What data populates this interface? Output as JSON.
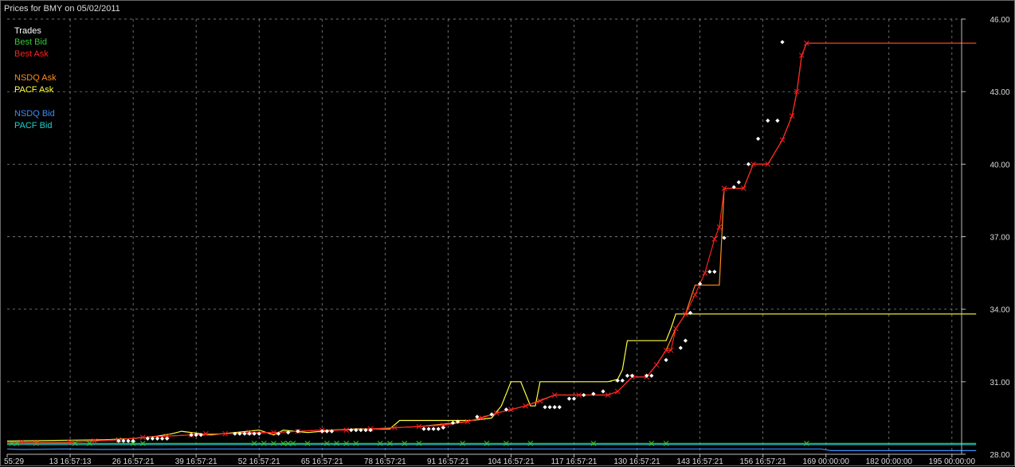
{
  "chart_data": {
    "type": "line",
    "title": "Prices for BMY on 05/02/2011",
    "xlabel": "",
    "ylabel": "",
    "ylim": [
      28.0,
      46.0
    ],
    "xlim": [
      0,
      197
    ],
    "grid": true,
    "legend": "top-left",
    "y_ticks": [
      "46.00",
      "43.00",
      "40.00",
      "37.00",
      "34.00",
      "31.00",
      "28.00"
    ],
    "y_tick_values": [
      46,
      43,
      40,
      37,
      34,
      31,
      28
    ],
    "x_ticks": [
      {
        "x": 0,
        "label": "55:29"
      },
      {
        "x": 13,
        "label": "13 16:57:13"
      },
      {
        "x": 26,
        "label": "26 16:57:21"
      },
      {
        "x": 39,
        "label": "39 16:57:21"
      },
      {
        "x": 52,
        "label": "52 16:57:21"
      },
      {
        "x": 65,
        "label": "65 16:57:21"
      },
      {
        "x": 78,
        "label": "78 16:57:21"
      },
      {
        "x": 91,
        "label": "91 16:57:21"
      },
      {
        "x": 104,
        "label": "104 16:57:21"
      },
      {
        "x": 117,
        "label": "117 16:57:21"
      },
      {
        "x": 130,
        "label": "130 16:57:21"
      },
      {
        "x": 143,
        "label": "143 16:57:21"
      },
      {
        "x": 156,
        "label": "156 16:57:21"
      },
      {
        "x": 169,
        "label": "169 00:00:00"
      },
      {
        "x": 182,
        "label": "182 00:00:00"
      },
      {
        "x": 195,
        "label": "195 00:00:00"
      }
    ],
    "legend_entries": [
      {
        "name": "Trades",
        "color": "#ffffff"
      },
      {
        "name": "Best Bid",
        "color": "#32cd32"
      },
      {
        "name": "Best Ask",
        "color": "#ff2020"
      },
      {
        "name": "NSDQ Ask",
        "color": "#ff8c1a"
      },
      {
        "name": "PACF Ask",
        "color": "#ffff40"
      },
      {
        "name": "NSDQ Bid",
        "color": "#3a8cff"
      },
      {
        "name": "PACF Bid",
        "color": "#20d0d0"
      }
    ],
    "series": [
      {
        "name": "Best Ask",
        "kind": "step-line-with-x-markers",
        "color": "#ff2020",
        "points": [
          [
            0,
            28.5
          ],
          [
            3,
            28.5
          ],
          [
            6,
            28.5
          ],
          [
            13,
            28.5
          ],
          [
            18,
            28.55
          ],
          [
            23,
            28.6
          ],
          [
            28,
            28.7
          ],
          [
            33,
            28.75
          ],
          [
            38,
            28.8
          ],
          [
            41,
            28.85
          ],
          [
            45,
            28.85
          ],
          [
            50,
            28.9
          ],
          [
            55,
            28.9
          ],
          [
            60,
            28.95
          ],
          [
            65,
            29.0
          ],
          [
            70,
            29.0
          ],
          [
            75,
            29.05
          ],
          [
            80,
            29.1
          ],
          [
            85,
            29.15
          ],
          [
            90,
            29.2
          ],
          [
            95,
            29.35
          ],
          [
            98,
            29.5
          ],
          [
            101,
            29.7
          ],
          [
            104,
            29.85
          ],
          [
            107,
            30.0
          ],
          [
            110,
            30.2
          ],
          [
            113,
            30.45
          ],
          [
            118,
            30.45
          ],
          [
            124,
            30.45
          ],
          [
            126,
            30.6
          ],
          [
            129,
            31.2
          ],
          [
            132,
            31.2
          ],
          [
            134,
            31.7
          ],
          [
            136,
            32.3
          ],
          [
            137,
            32.3
          ],
          [
            138,
            33.2
          ],
          [
            140,
            33.8
          ],
          [
            142,
            34.6
          ],
          [
            144,
            35.5
          ],
          [
            146,
            36.9
          ],
          [
            147,
            37.4
          ],
          [
            148,
            39.0
          ],
          [
            152,
            39.0
          ],
          [
            154,
            40.0
          ],
          [
            157,
            40.0
          ],
          [
            160,
            41.0
          ],
          [
            162,
            42.0
          ],
          [
            163,
            43.0
          ],
          [
            164,
            44.5
          ],
          [
            165,
            45.0
          ],
          [
            200,
            45.0
          ]
        ]
      },
      {
        "name": "NSDQ Ask",
        "kind": "step-line",
        "color": "#ff8c1a",
        "points": [
          [
            0,
            28.5
          ],
          [
            13,
            28.5
          ],
          [
            18,
            28.55
          ],
          [
            23,
            28.6
          ],
          [
            28,
            28.7
          ],
          [
            33,
            28.75
          ],
          [
            38,
            28.8
          ],
          [
            45,
            28.85
          ],
          [
            55,
            28.9
          ],
          [
            65,
            29.0
          ],
          [
            75,
            29.05
          ],
          [
            85,
            29.15
          ],
          [
            95,
            29.35
          ],
          [
            101,
            29.7
          ],
          [
            107,
            30.0
          ],
          [
            113,
            30.45
          ],
          [
            124,
            30.45
          ],
          [
            126,
            30.6
          ],
          [
            129,
            31.2
          ],
          [
            132,
            31.2
          ],
          [
            134,
            31.7
          ],
          [
            136,
            32.3
          ],
          [
            138,
            33.2
          ],
          [
            140,
            33.8
          ],
          [
            142,
            35.0
          ],
          [
            147,
            35.0
          ],
          [
            148,
            39.0
          ],
          [
            152,
            39.0
          ],
          [
            154,
            40.0
          ],
          [
            157,
            40.0
          ],
          [
            160,
            41.0
          ],
          [
            162,
            42.0
          ],
          [
            163,
            43.0
          ],
          [
            164,
            44.5
          ],
          [
            165,
            45.0
          ],
          [
            200,
            45.0
          ]
        ]
      },
      {
        "name": "PACF Ask",
        "kind": "line",
        "color": "#ffff40",
        "points": [
          [
            0,
            28.55
          ],
          [
            20,
            28.6
          ],
          [
            26,
            28.65
          ],
          [
            31,
            28.75
          ],
          [
            34,
            28.85
          ],
          [
            36,
            28.95
          ],
          [
            42,
            28.8
          ],
          [
            47,
            28.9
          ],
          [
            52,
            29.0
          ],
          [
            55,
            28.8
          ],
          [
            57,
            29.0
          ],
          [
            62,
            28.9
          ],
          [
            68,
            29.0
          ],
          [
            72,
            29.05
          ],
          [
            75,
            29.05
          ],
          [
            79,
            29.05
          ],
          [
            81,
            29.4
          ],
          [
            96,
            29.4
          ],
          [
            100,
            29.5
          ],
          [
            102,
            30.0
          ],
          [
            104,
            31.0
          ],
          [
            106,
            31.0
          ],
          [
            108,
            30.0
          ],
          [
            109,
            30.0
          ],
          [
            110,
            31.0
          ],
          [
            124,
            31.0
          ],
          [
            126,
            31.1
          ],
          [
            127,
            31.5
          ],
          [
            128,
            32.7
          ],
          [
            136,
            32.7
          ],
          [
            137,
            33.2
          ],
          [
            138,
            33.8
          ],
          [
            200,
            33.8
          ]
        ]
      },
      {
        "name": "Best Bid",
        "kind": "line-with-x-markers",
        "color": "#32cd32",
        "points": [
          [
            0,
            28.45
          ],
          [
            200,
            28.45
          ]
        ]
      },
      {
        "name": "PACF Bid",
        "kind": "line",
        "color": "#20d0d0",
        "points": [
          [
            0,
            28.4
          ],
          [
            200,
            28.4
          ]
        ]
      },
      {
        "name": "NSDQ Bid",
        "kind": "line",
        "color": "#3a8cff",
        "points": [
          [
            0,
            28.22
          ],
          [
            3,
            28.2
          ],
          [
            12,
            28.22
          ],
          [
            20,
            28.2
          ],
          [
            40,
            28.22
          ],
          [
            100,
            28.22
          ],
          [
            168,
            28.22
          ],
          [
            170,
            28.15
          ],
          [
            200,
            28.15
          ]
        ]
      },
      {
        "name": "Trades",
        "kind": "diamonds",
        "color": "#ffffff",
        "points": [
          [
            23,
            28.55
          ],
          [
            24,
            28.55
          ],
          [
            25,
            28.55
          ],
          [
            26,
            28.55
          ],
          [
            29,
            28.65
          ],
          [
            30,
            28.65
          ],
          [
            31,
            28.65
          ],
          [
            32,
            28.65
          ],
          [
            33,
            28.65
          ],
          [
            38,
            28.8
          ],
          [
            39,
            28.8
          ],
          [
            40,
            28.8
          ],
          [
            47,
            28.85
          ],
          [
            48,
            28.85
          ],
          [
            49,
            28.85
          ],
          [
            50,
            28.85
          ],
          [
            51,
            28.85
          ],
          [
            52,
            28.85
          ],
          [
            56,
            28.85
          ],
          [
            58,
            28.9
          ],
          [
            60,
            28.95
          ],
          [
            65,
            28.95
          ],
          [
            66,
            28.95
          ],
          [
            67,
            28.95
          ],
          [
            71,
            29.0
          ],
          [
            72,
            29.0
          ],
          [
            73,
            29.0
          ],
          [
            74,
            29.0
          ],
          [
            75,
            29.0
          ],
          [
            86,
            29.05
          ],
          [
            87,
            29.05
          ],
          [
            88,
            29.05
          ],
          [
            89,
            29.05
          ],
          [
            90,
            29.1
          ],
          [
            92,
            29.3
          ],
          [
            93,
            29.35
          ],
          [
            97,
            29.55
          ],
          [
            100,
            29.65
          ],
          [
            103,
            29.85
          ],
          [
            111,
            29.95
          ],
          [
            112,
            29.95
          ],
          [
            113,
            29.95
          ],
          [
            114,
            29.95
          ],
          [
            116,
            30.3
          ],
          [
            117,
            30.3
          ],
          [
            119,
            30.45
          ],
          [
            121,
            30.5
          ],
          [
            123,
            30.6
          ],
          [
            126,
            31.05
          ],
          [
            127,
            31.05
          ],
          [
            128,
            31.25
          ],
          [
            129,
            31.25
          ],
          [
            132,
            31.25
          ],
          [
            133,
            31.25
          ],
          [
            136,
            31.9
          ],
          [
            139,
            32.4
          ],
          [
            140,
            32.7
          ],
          [
            141,
            33.85
          ],
          [
            143,
            35.05
          ],
          [
            145,
            35.55
          ],
          [
            146,
            35.55
          ],
          [
            148,
            36.95
          ],
          [
            150,
            39.05
          ],
          [
            151,
            39.25
          ],
          [
            153,
            40.0
          ],
          [
            155,
            41.05
          ],
          [
            157,
            41.8
          ],
          [
            159,
            41.8
          ],
          [
            160,
            45.05
          ]
        ]
      }
    ]
  }
}
